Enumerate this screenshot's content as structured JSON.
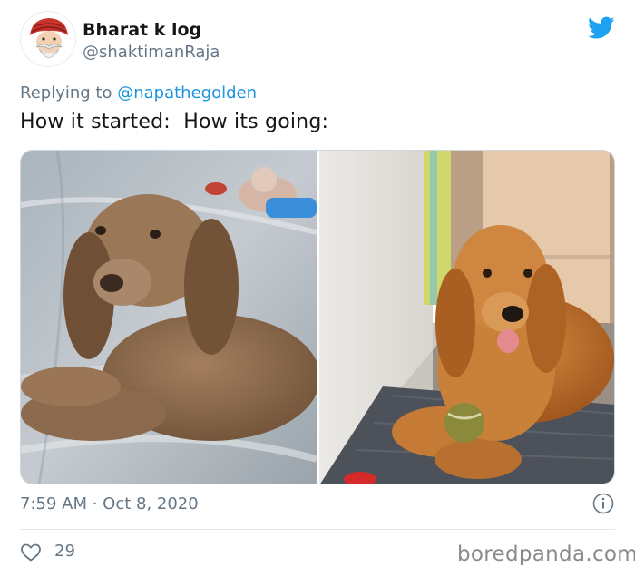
{
  "tweet": {
    "author_name": "Bharat k log",
    "author_handle": "@shaktimanRaja",
    "reply_prefix": "Replying to ",
    "reply_mention": "@napathegolden",
    "text": "How it started:  How its going:",
    "timestamp": "7:59 AM · Oct 8, 2020",
    "likes": "29"
  },
  "media": {
    "left_image": "puppy-cocker-spaniel",
    "right_image": "adult-cocker-spaniel-with-ball"
  },
  "watermark": "boredpanda.com",
  "icons": {
    "bird": "twitter-bird-icon",
    "info": "info-icon",
    "heart": "heart-icon"
  },
  "colors": {
    "twitter_blue": "#1da1f2",
    "link_blue": "#1b95e0",
    "secondary_text": "#657786",
    "primary_text": "#14171a"
  }
}
